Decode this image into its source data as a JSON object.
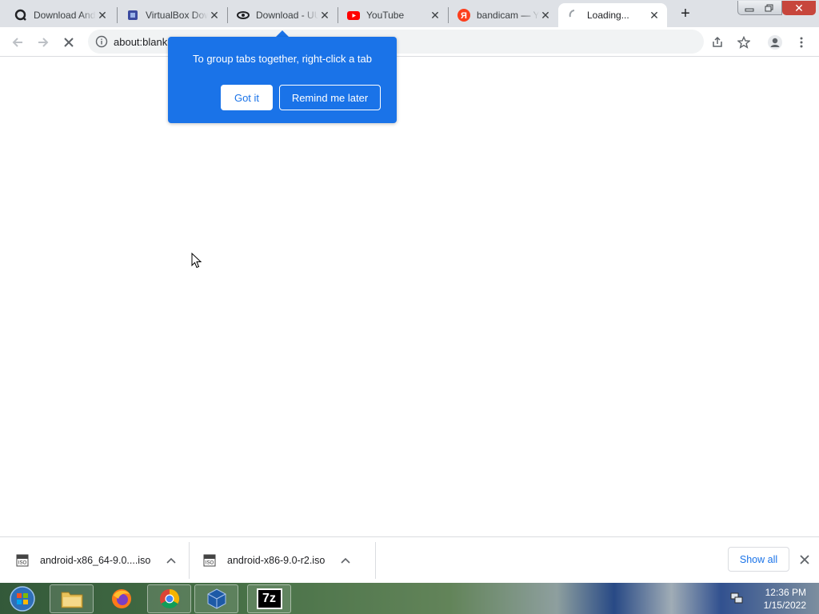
{
  "tabs": [
    {
      "title": "Download Android x86",
      "icon": "search-globe-icon",
      "active": false
    },
    {
      "title": "VirtualBox Downloads",
      "icon": "virtualbox-icon",
      "active": false
    },
    {
      "title": "Download - UUByte",
      "icon": "eye-logo-icon",
      "active": false
    },
    {
      "title": "YouTube",
      "icon": "youtube-icon",
      "active": false
    },
    {
      "title": "bandicam — Yandex",
      "icon": "yandex-icon",
      "active": false
    },
    {
      "title": "Loading...",
      "icon": "loading-spinner-icon",
      "active": true
    }
  ],
  "window_controls": {
    "minimize": "minimize",
    "restore": "restore",
    "close": "close"
  },
  "address_bar": {
    "url": "about:blank"
  },
  "promo_bubble": {
    "message": "To group tabs together, right-click a tab",
    "primary_button": "Got it",
    "secondary_button": "Remind me later"
  },
  "downloads": [
    {
      "filename": "android-x86_64-9.0....iso"
    },
    {
      "filename": "android-x86-9.0-r2.iso"
    }
  ],
  "downloads_shelf": {
    "show_all": "Show all"
  },
  "taskbar": {
    "apps": [
      "start-orb",
      "file-explorer",
      "firefox",
      "chrome",
      "virtualbox",
      "7-zip"
    ],
    "sevenzip_label": "7z",
    "clock_time": "12:36 PM",
    "clock_date": "1/15/2022"
  },
  "colors": {
    "accent": "#1a73e8",
    "tabstrip": "#dee1e6",
    "close_red": "#c7463c"
  }
}
